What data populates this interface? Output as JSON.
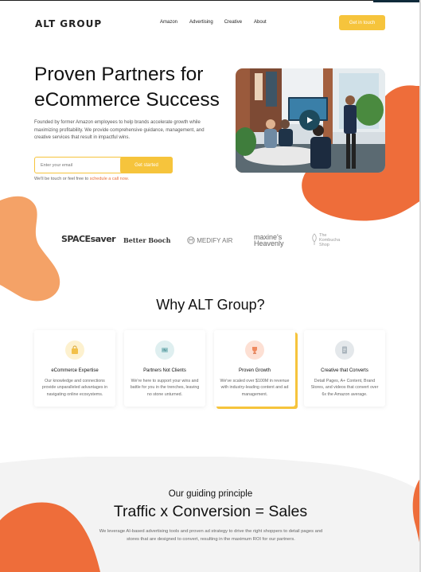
{
  "header": {
    "logo": "ALT GROUP",
    "nav": [
      "Amazon",
      "Advertising",
      "Creative",
      "About"
    ],
    "cta": "Get in touch"
  },
  "hero": {
    "title_line1": "Proven Partners for",
    "title_line2": "eCommerce Success",
    "subtitle": "Founded by former Amazon employees to help brands accelerate growth while maximizing profitability. We provide comprehensive guidance, management, and creative services that result in impactful wins.",
    "email_placeholder": "Enter your email",
    "email_button": "Get started",
    "touch_text": "We'll be touch or feel free to ",
    "touch_link": "schedule a call now."
  },
  "brands": {
    "space": "SPACEsaver",
    "better": "Better Booch",
    "medify": "MEDIFY AIR",
    "maxine1": "maxine's",
    "maxine2": "Heavenly",
    "kombucha1": "The",
    "kombucha2": "Kombucha",
    "kombucha3": "Shop"
  },
  "why": {
    "title": "Why ALT Group?",
    "cards": [
      {
        "title": "eCommerce Expertise",
        "text": "Our knowledge and connections provide unparalleled advantages in navigating online ecosystems.",
        "icon": "bag-icon",
        "bg": "#fdf1cf"
      },
      {
        "title": "Partners Not Clients",
        "text": "We're here to support your wins and battle for you in the trenches, leaving no stone unturned.",
        "icon": "handshake-icon",
        "bg": "#dfeff0"
      },
      {
        "title": "Proven Growth",
        "text": "We've scaled over $100M in revenue with industry-leading content and ad management.",
        "icon": "trophy-icon",
        "bg": "#fde0d4"
      },
      {
        "title": "Creative that Converts",
        "text": "Detail Pages, A+ Content, Brand Stores, and videos that convert over 6x the Amazon average.",
        "icon": "document-icon",
        "bg": "#e4e8eb"
      }
    ]
  },
  "principle": {
    "label": "Our guiding principle",
    "headline": "Traffic x Conversion = Sales",
    "text": "We leverage AI-based advertising tools and proven ad strategy to drive the right shoppers to detail pages and stores that are designed to convert, resulting in the maximum ROI for our partners."
  },
  "colors": {
    "accent_yellow": "#f6c43c",
    "accent_orange": "#ee6d3a",
    "peach": "#f4a267",
    "bottom_bg": "#f3f3f3"
  }
}
